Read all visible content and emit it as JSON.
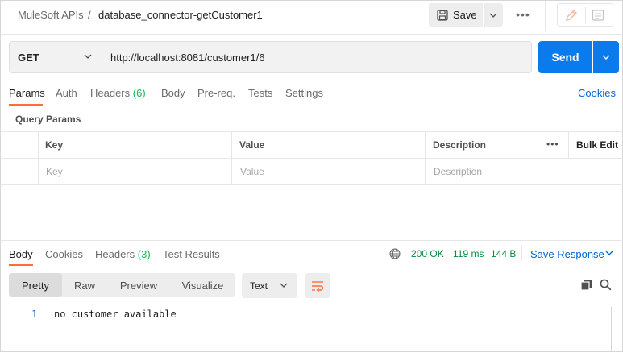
{
  "header": {
    "breadcrumb_parent": "MuleSoft APIs",
    "breadcrumb_separator": "/",
    "request_name": "database_connector-getCustomer1",
    "save_label": "Save",
    "more_label": "•••"
  },
  "request": {
    "method": "GET",
    "url": "http://localhost:8081/customer1/6",
    "send_label": "Send"
  },
  "request_tabs": [
    {
      "label": "Params",
      "active": true
    },
    {
      "label": "Auth"
    },
    {
      "label": "Headers",
      "count": "(6)"
    },
    {
      "label": "Body"
    },
    {
      "label": "Pre-req."
    },
    {
      "label": "Tests"
    },
    {
      "label": "Settings"
    }
  ],
  "cookies_label": "Cookies",
  "query_params": {
    "title": "Query Params",
    "columns": [
      "Key",
      "Value",
      "Description"
    ],
    "more_label": "•••",
    "bulk_edit_label": "Bulk Edit",
    "placeholders": [
      "Key",
      "Value",
      "Description"
    ]
  },
  "response": {
    "tabs": [
      {
        "label": "Body",
        "active": true
      },
      {
        "label": "Cookies"
      },
      {
        "label": "Headers",
        "count": "(3)"
      },
      {
        "label": "Test Results"
      }
    ],
    "status": "200 OK",
    "time": "119 ms",
    "size": "144 B",
    "save_response_label": "Save Response",
    "views": [
      "Pretty",
      "Raw",
      "Preview",
      "Visualize"
    ],
    "active_view": "Pretty",
    "format": "Text",
    "lines": [
      {
        "number": "1",
        "text": "no customer available"
      }
    ]
  },
  "colors": {
    "accent": "#ff6c37",
    "primary": "#097bed",
    "link": "#0265d2",
    "success": "#0a8c3e"
  }
}
